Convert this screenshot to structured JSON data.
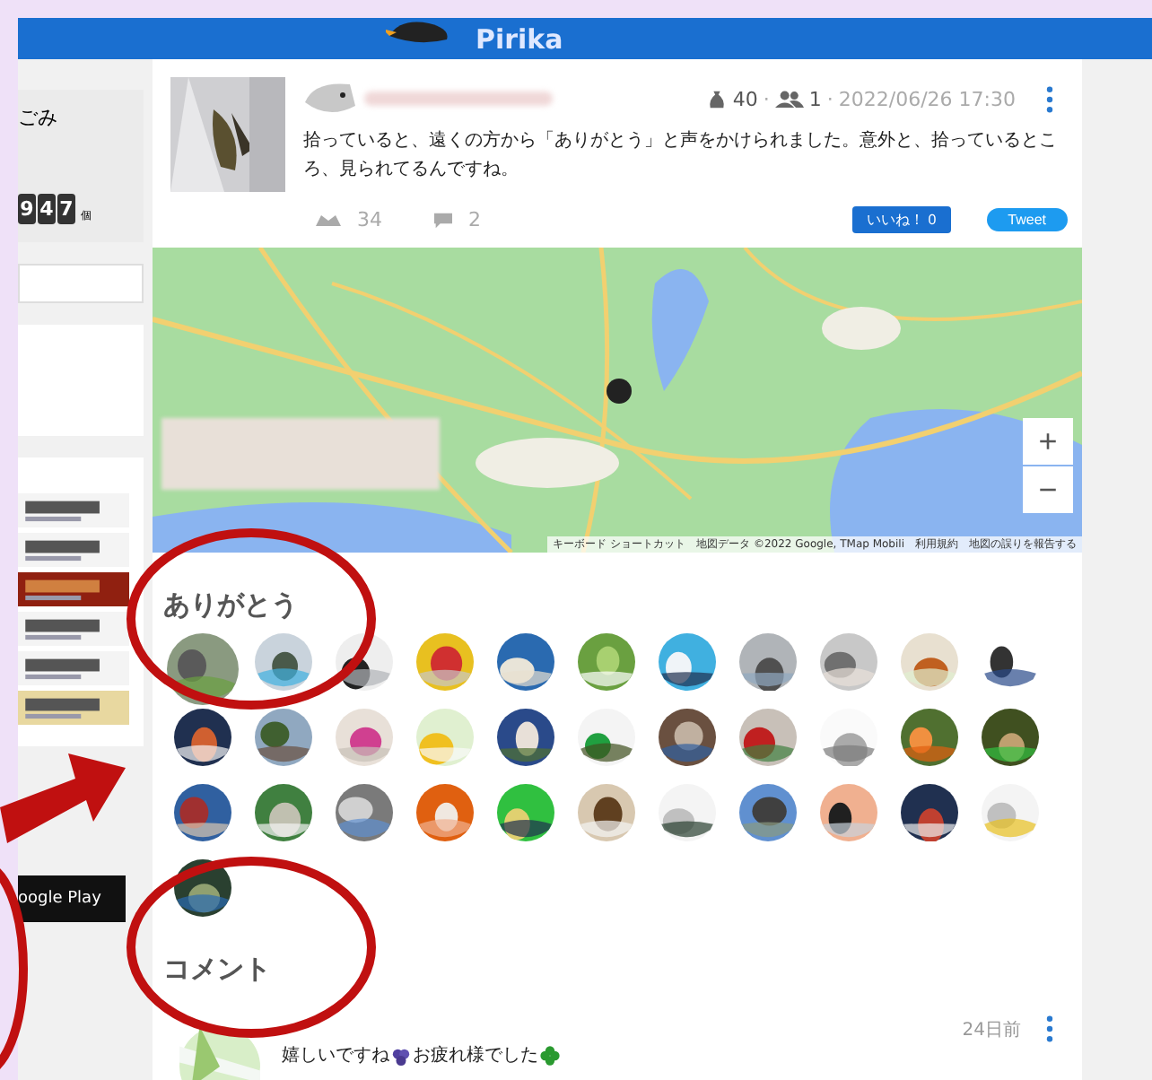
{
  "header": {
    "brand": "Pirika"
  },
  "sidebar": {
    "label": "ごみ",
    "counter_digits": [
      "9",
      "4",
      "7"
    ],
    "counter_unit": "個",
    "banners": [
      {
        "kind": "picture"
      },
      {
        "kind": "picture"
      },
      {
        "kind": "picture"
      },
      {
        "kind": "picture"
      },
      {
        "kind": "picture"
      },
      {
        "kind": "picture"
      }
    ],
    "app_badge": "oogle Play"
  },
  "post": {
    "bags": "40",
    "people": "1",
    "separator": "·",
    "date": "2022/06/26 17:30",
    "text": "拾っていると、遠くの方から「ありがとう」と声をかけられました。意外と、拾っているところ、見られてるんですね。",
    "thanks_count": "34",
    "comment_count": "2",
    "like_label": "いいね！",
    "like_count": "0",
    "tweet_label": "Tweet"
  },
  "map": {
    "zoom_in": "+",
    "zoom_out": "−",
    "attribution": [
      "キーボード ショートカット",
      "地図データ ©2022 Google, TMap Mobili",
      "利用規約",
      "地図の誤りを報告する"
    ]
  },
  "thanks": {
    "title": "ありがとう",
    "avatars": [
      {
        "kind": "picture"
      },
      {
        "kind": "picture"
      },
      {
        "kind": "picture"
      },
      {
        "kind": "picture"
      },
      {
        "kind": "picture"
      },
      {
        "kind": "picture"
      },
      {
        "kind": "picture"
      },
      {
        "kind": "picture"
      },
      {
        "kind": "picture"
      },
      {
        "kind": "picture"
      },
      {
        "kind": "picture"
      },
      {
        "kind": "picture"
      },
      {
        "kind": "picture"
      },
      {
        "kind": "picture"
      },
      {
        "kind": "picture"
      },
      {
        "kind": "picture"
      },
      {
        "kind": "picture"
      },
      {
        "kind": "picture"
      },
      {
        "kind": "picture"
      },
      {
        "kind": "picture"
      },
      {
        "kind": "picture"
      },
      {
        "kind": "picture"
      },
      {
        "kind": "picture"
      },
      {
        "kind": "picture"
      },
      {
        "kind": "picture"
      },
      {
        "kind": "picture"
      },
      {
        "kind": "picture"
      },
      {
        "kind": "picture"
      },
      {
        "kind": "picture"
      },
      {
        "kind": "picture"
      },
      {
        "kind": "picture"
      },
      {
        "kind": "picture"
      },
      {
        "kind": "picture"
      },
      {
        "kind": "picture"
      }
    ]
  },
  "comments": {
    "title": "コメント",
    "items": [
      {
        "time": "24日前",
        "text_parts": [
          "嬉しいですね",
          "お疲れ様でした"
        ]
      }
    ]
  }
}
